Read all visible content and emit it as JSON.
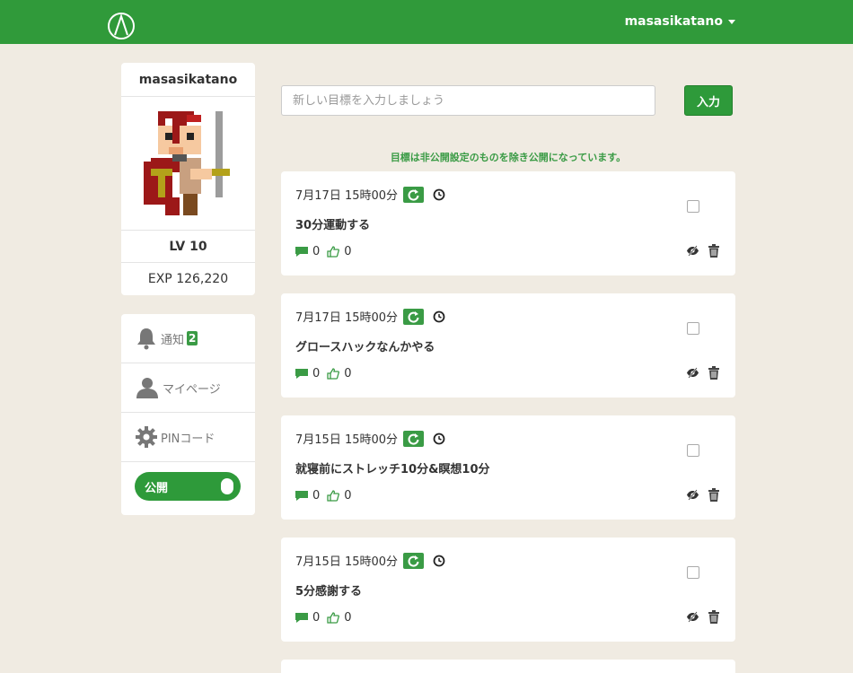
{
  "navbar": {
    "username": "masasikatano"
  },
  "profile": {
    "name": "masasikatano",
    "level": "LV 10",
    "exp": "EXP 126,220"
  },
  "menu": {
    "notifications": {
      "label": "通知",
      "badge": "2"
    },
    "mypage": {
      "label": "マイページ"
    },
    "pin": {
      "label": "PINコード"
    },
    "public_toggle": {
      "label": "公開",
      "on": true
    }
  },
  "goal_form": {
    "placeholder": "新しい目標を入力しましょう",
    "submit_label": "入力"
  },
  "notice": "目標は非公開設定のものを除き公開になっています。",
  "goals": [
    {
      "datetime": "7月17日 15時00分",
      "title": "30分運動する",
      "comments": "0",
      "likes": "0"
    },
    {
      "datetime": "7月17日 15時00分",
      "title": "グロースハックなんかやる",
      "comments": "0",
      "likes": "0"
    },
    {
      "datetime": "7月15日 15時00分",
      "title": "就寝前にストレッチ10分&瞑想10分",
      "comments": "0",
      "likes": "0"
    },
    {
      "datetime": "7月15日 15時00分",
      "title": "5分感謝する",
      "comments": "0",
      "likes": "0"
    }
  ],
  "colors": {
    "brand": "#309a3a",
    "background": "#f0ebe2",
    "accent": "#3a9b45"
  },
  "icons": [
    "logo-icon",
    "caret-down-icon",
    "bell-icon",
    "user-icon",
    "gear-icon",
    "repeat-icon",
    "clock-icon",
    "comment-icon",
    "thumbs-up-icon",
    "hide-icon",
    "trash-icon"
  ]
}
